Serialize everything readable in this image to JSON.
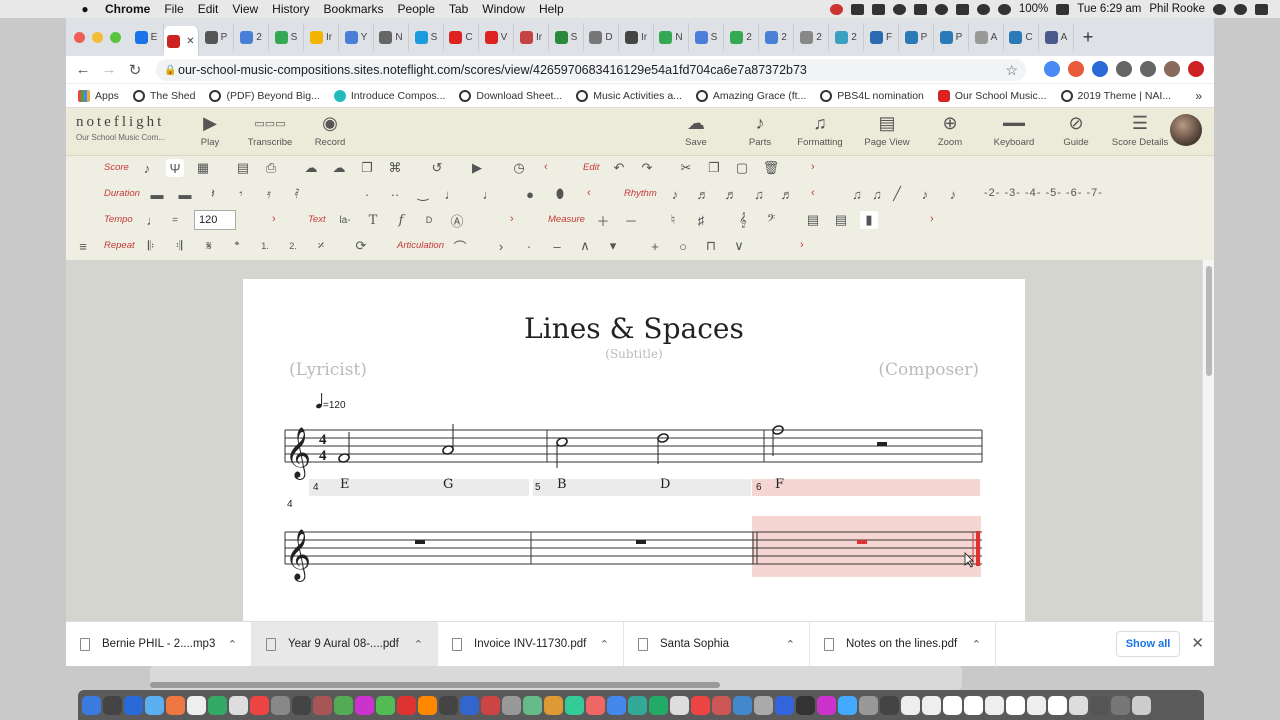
{
  "menubar": {
    "app": "Chrome",
    "items": [
      "File",
      "Edit",
      "View",
      "History",
      "Bookmarks",
      "People",
      "Tab",
      "Window",
      "Help"
    ],
    "battery": "100%",
    "clock": "Tue 6:29 am",
    "user": "Phil Rooke"
  },
  "tabs": [
    {
      "label": "E",
      "color": "#1a73e8"
    },
    {
      "label": "",
      "color": "#cc2222"
    },
    {
      "label": "P",
      "color": "#555555"
    },
    {
      "label": "2",
      "color": "#4a7fd8"
    },
    {
      "label": "S",
      "color": "#34a853"
    },
    {
      "label": "Ir",
      "color": "#f4b400"
    },
    {
      "label": "Y",
      "color": "#4a7fd8"
    },
    {
      "label": "N",
      "color": "#666666"
    },
    {
      "label": "S",
      "color": "#1a9be0"
    },
    {
      "label": "C",
      "color": "#dd2222"
    },
    {
      "label": "V",
      "color": "#dd2222"
    },
    {
      "label": "Ir",
      "color": "#c44444"
    },
    {
      "label": "S",
      "color": "#2a8a3a"
    },
    {
      "label": "D",
      "color": "#777777"
    },
    {
      "label": "Ir",
      "color": "#444444"
    },
    {
      "label": "N",
      "color": "#34a853"
    },
    {
      "label": "S",
      "color": "#4a7fd8"
    },
    {
      "label": "2",
      "color": "#34a853"
    },
    {
      "label": "2",
      "color": "#4a7fd8"
    },
    {
      "label": "2",
      "color": "#888888"
    },
    {
      "label": "2",
      "color": "#3aa0c0"
    },
    {
      "label": "F",
      "color": "#2a6ab0"
    },
    {
      "label": "P",
      "color": "#2a7ab8"
    },
    {
      "label": "P",
      "color": "#2a7ab8"
    },
    {
      "label": "A",
      "color": "#999999"
    },
    {
      "label": "C",
      "color": "#2a7ab8"
    },
    {
      "label": "A",
      "color": "#4a5a8a"
    }
  ],
  "active_tab_close": "✕",
  "address": {
    "url": "our-school-music-compositions.sites.noteflight.com/scores/view/4265970683416129e54a1fd704ca6e7a87372b73"
  },
  "bookmarks": [
    {
      "label": "Apps",
      "icon": "apps-grid-icon"
    },
    {
      "label": "The Shed",
      "icon": "globe-icon"
    },
    {
      "label": "(PDF) Beyond Big...",
      "icon": "globe-icon"
    },
    {
      "label": "Introduce Compos...",
      "icon": "teal-icon"
    },
    {
      "label": "Download Sheet...",
      "icon": "globe-icon"
    },
    {
      "label": "Music Activities a...",
      "icon": "globe-icon"
    },
    {
      "label": "Amazing Grace (ft...",
      "icon": "globe-icon"
    },
    {
      "label": "PBS4L nomination",
      "icon": "globe-icon"
    },
    {
      "label": "Our School Music...",
      "icon": "youtube-icon"
    },
    {
      "label": "2019 Theme | NAI...",
      "icon": "globe-icon"
    }
  ],
  "noteflight": {
    "logo": "noteflight",
    "logo_sub": "Our School Music Com...",
    "header_buttons": {
      "play": "Play",
      "transcribe": "Transcribe",
      "record": "Record",
      "save": "Save",
      "parts": "Parts",
      "formatting": "Formatting",
      "page_view": "Page View",
      "zoom": "Zoom",
      "keyboard": "Keyboard",
      "guide": "Guide",
      "score_details": "Score Details"
    }
  },
  "palette": {
    "score": "Score",
    "edit": "Edit",
    "duration": "Duration",
    "rhythm": "Rhythm",
    "tempo": "Tempo",
    "tempo_eq": "=",
    "tempo_value": "120",
    "text": "Text",
    "measure": "Measure",
    "repeat": "Repeat",
    "articulation": "Articulation",
    "tuplets": "-2- -3- -4- -5- -6- -7-",
    "lyric_tool": "la-",
    "text_tool": "T",
    "dynamics_tool": "f",
    "chord_tool": "D"
  },
  "score": {
    "title": "Lines & Spaces",
    "subtitle": "(Subtitle)",
    "lyricist": "(Lyricist)",
    "composer": "(Composer)",
    "tempo_mark": "=120",
    "time_sig": [
      "4",
      "4"
    ],
    "second_system_number": "4",
    "lyrics": [
      {
        "measure": "4",
        "syllables": [
          "E",
          "G"
        ]
      },
      {
        "measure": "5",
        "syllables": [
          "B",
          "D"
        ]
      },
      {
        "measure": "6",
        "syllables": [
          "F"
        ]
      }
    ]
  },
  "downloads": [
    {
      "name": "Bernie PHIL - 2....mp3"
    },
    {
      "name": "Year 9 Aural 08-....pdf"
    },
    {
      "name": "Invoice INV-11730.pdf"
    },
    {
      "name": "Santa Sophia"
    },
    {
      "name": "Notes on the lines.pdf"
    }
  ],
  "show_all": "Show all",
  "dock_colors": [
    "#3a7be0",
    "#444",
    "#2a6ad8",
    "#5ab0f0",
    "#e74",
    "#eee",
    "#3a6",
    "#ddd",
    "#e44",
    "#888",
    "#444",
    "#a55",
    "#5a5",
    "#c3c",
    "#5b5",
    "#d33",
    "#f80",
    "#444",
    "#36c",
    "#c44",
    "#999",
    "#6b8",
    "#d93",
    "#3c9",
    "#e66",
    "#48e",
    "#3a9",
    "#2a6",
    "#ddd",
    "#e44",
    "#c55",
    "#48c",
    "#aaa",
    "#36d",
    "#333",
    "#c3c",
    "#4af",
    "#999",
    "#444",
    "#eee",
    "#eee",
    "#fff",
    "#fff",
    "#eee",
    "#fff",
    "#eee",
    "#fff",
    "#ddd",
    "#555",
    "#777",
    "#ccc"
  ]
}
